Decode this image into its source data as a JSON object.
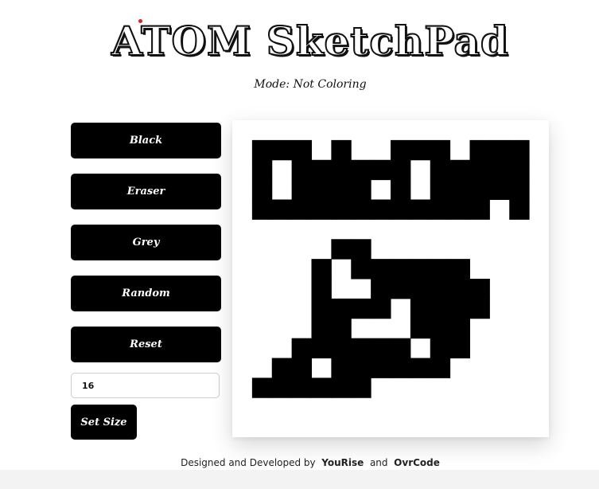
{
  "app": {
    "title": "ATOM SketchPad"
  },
  "status": {
    "mode_label": "Mode:",
    "mode_value": "Not Coloring"
  },
  "controls": {
    "buttons": [
      "Black",
      "Eraser",
      "Grey",
      "Random",
      "Reset"
    ],
    "size_input_value": "16",
    "set_size_label": "Set Size"
  },
  "grid": {
    "size": 16,
    "fill_color": "#000000",
    "filled_cells": [
      [
        1,
        1
      ],
      [
        2,
        1
      ],
      [
        3,
        1
      ],
      [
        5,
        1
      ],
      [
        8,
        1
      ],
      [
        9,
        1
      ],
      [
        10,
        1
      ],
      [
        12,
        1
      ],
      [
        13,
        1
      ],
      [
        14,
        1
      ],
      [
        1,
        2
      ],
      [
        3,
        2
      ],
      [
        4,
        2
      ],
      [
        5,
        2
      ],
      [
        6,
        2
      ],
      [
        7,
        2
      ],
      [
        8,
        2
      ],
      [
        10,
        2
      ],
      [
        11,
        2
      ],
      [
        12,
        2
      ],
      [
        13,
        2
      ],
      [
        14,
        2
      ],
      [
        1,
        3
      ],
      [
        3,
        3
      ],
      [
        4,
        3
      ],
      [
        5,
        3
      ],
      [
        6,
        3
      ],
      [
        8,
        3
      ],
      [
        10,
        3
      ],
      [
        11,
        3
      ],
      [
        12,
        3
      ],
      [
        13,
        3
      ],
      [
        14,
        3
      ],
      [
        1,
        4
      ],
      [
        2,
        4
      ],
      [
        3,
        4
      ],
      [
        4,
        4
      ],
      [
        5,
        4
      ],
      [
        6,
        4
      ],
      [
        7,
        4
      ],
      [
        8,
        4
      ],
      [
        9,
        4
      ],
      [
        10,
        4
      ],
      [
        11,
        4
      ],
      [
        12,
        4
      ],
      [
        14,
        4
      ],
      [
        5,
        6
      ],
      [
        6,
        6
      ],
      [
        4,
        7
      ],
      [
        6,
        7
      ],
      [
        7,
        7
      ],
      [
        8,
        7
      ],
      [
        9,
        7
      ],
      [
        10,
        7
      ],
      [
        11,
        7
      ],
      [
        4,
        8
      ],
      [
        7,
        8
      ],
      [
        8,
        8
      ],
      [
        9,
        8
      ],
      [
        10,
        8
      ],
      [
        11,
        8
      ],
      [
        12,
        8
      ],
      [
        4,
        9
      ],
      [
        5,
        9
      ],
      [
        6,
        9
      ],
      [
        7,
        9
      ],
      [
        9,
        9
      ],
      [
        10,
        9
      ],
      [
        11,
        9
      ],
      [
        12,
        9
      ],
      [
        4,
        10
      ],
      [
        5,
        10
      ],
      [
        9,
        10
      ],
      [
        10,
        10
      ],
      [
        11,
        10
      ],
      [
        3,
        11
      ],
      [
        4,
        11
      ],
      [
        5,
        11
      ],
      [
        6,
        11
      ],
      [
        7,
        11
      ],
      [
        8,
        11
      ],
      [
        10,
        11
      ],
      [
        11,
        11
      ],
      [
        2,
        12
      ],
      [
        3,
        12
      ],
      [
        5,
        12
      ],
      [
        6,
        12
      ],
      [
        7,
        12
      ],
      [
        8,
        12
      ],
      [
        9,
        12
      ],
      [
        10,
        12
      ],
      [
        1,
        13
      ],
      [
        2,
        13
      ],
      [
        3,
        13
      ],
      [
        4,
        13
      ],
      [
        5,
        13
      ],
      [
        6,
        13
      ]
    ]
  },
  "footer": {
    "text": "Designed and Developed by",
    "author1": "YouRise",
    "joiner": "and",
    "author2": "OvrCode"
  }
}
